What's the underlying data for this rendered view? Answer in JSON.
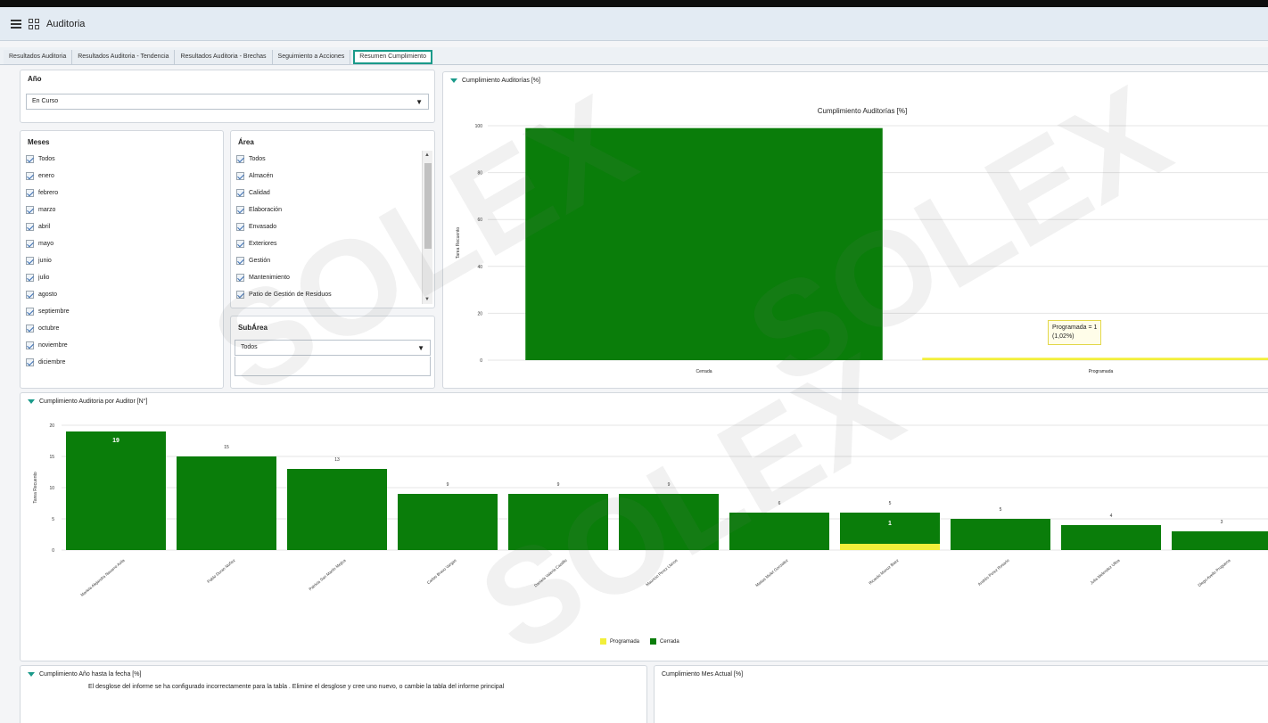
{
  "app": {
    "title": "Auditoria"
  },
  "tabs": [
    {
      "label": "Resultados Auditoria",
      "active": false
    },
    {
      "label": "Resultados Auditoria - Tendencia",
      "active": false
    },
    {
      "label": "Resultados Auditoria - Brechas",
      "active": false
    },
    {
      "label": "Seguimiento a Acciones",
      "active": false
    },
    {
      "label": "Resumen Cumplimiento",
      "active": true
    }
  ],
  "filters": {
    "anio": {
      "label": "Año",
      "value": "En Curso"
    },
    "meses": {
      "label": "Meses",
      "items": [
        "Todos",
        "enero",
        "febrero",
        "marzo",
        "abril",
        "mayo",
        "junio",
        "julio",
        "agosto",
        "septiembre",
        "octubre",
        "noviembre",
        "diciembre"
      ]
    },
    "area": {
      "label": "Área",
      "items": [
        "Todos",
        "Almacén",
        "Calidad",
        "Elaboración",
        "Envasado",
        "Exteriores",
        "Gestión",
        "Mantenimiento",
        "Patio de Gestión de Residuos"
      ]
    },
    "subarea": {
      "label": "SubÁrea",
      "value": "Todos"
    }
  },
  "chart_top": {
    "panel_title": "Cumplimiento Auditorías [%]",
    "tooltip_line1": "Programada = 1",
    "tooltip_line2": "(1,02%)"
  },
  "chart_bottom": {
    "panel_title": "Cumplimiento Auditoria por Auditor [N°]"
  },
  "bottom_left": {
    "title": "Cumplimiento Año hasta la fecha [%]",
    "message": "El desglose del informe se ha configurado incorrectamente para la tabla . Elimine el desglose y cree uno nuevo, o cambie la tabla del informe principal"
  },
  "bottom_right": {
    "title": "Cumplimiento Mes Actual [%]"
  },
  "watermark": "SOLEX",
  "colors": {
    "cerrada": "#0a7d0a",
    "programada": "#f2ef3a",
    "accent": "#1a9a8a"
  },
  "chart_data": [
    {
      "type": "bar",
      "title": "Cumplimiento Auditorías [%]",
      "ylabel": "Tarea Recuento",
      "ylim": [
        0,
        100
      ],
      "yticks": [
        0,
        20,
        40,
        60,
        80,
        100
      ],
      "categories": [
        "Cerrada",
        "Programada"
      ],
      "values": [
        98.98,
        1.02
      ],
      "grid": true
    },
    {
      "type": "bar",
      "title": "Cumplimiento Auditoria por Auditor [N°]",
      "ylabel": "Tarea Recuento",
      "ylim": [
        0,
        20
      ],
      "yticks": [
        0,
        5,
        10,
        15,
        20
      ],
      "categories": [
        "Mariela Alejandra Navarro Avila",
        "Pablo Duran Nuñez",
        "Patricia San Martin Mejica",
        "Carlos Bravo Vargas",
        "Daniela Valeria Castillo",
        "Mauricio Perez Llanos",
        "Matias Mulet Gonzalez",
        "Ricardo Munoz Baez",
        "Andrés Perez Rosario",
        "Julia Melendez Ulloa",
        "Diego Avello Proguena"
      ],
      "series": [
        {
          "name": "Programada",
          "values": [
            0,
            0,
            0,
            0,
            0,
            0,
            0,
            1,
            0,
            0,
            0
          ]
        },
        {
          "name": "Cerrada",
          "values": [
            19,
            15,
            13,
            9,
            9,
            9,
            6,
            5,
            5,
            4,
            3
          ]
        }
      ],
      "top_labels": [
        "19",
        "15",
        "13",
        "9",
        "9",
        "9",
        "6",
        "5",
        "5",
        "4",
        "3"
      ],
      "inner_labels": [
        "",
        "",
        "",
        "",
        "",
        "",
        "",
        "1",
        "",
        "",
        ""
      ],
      "legend": "bottom",
      "grid": true
    }
  ]
}
